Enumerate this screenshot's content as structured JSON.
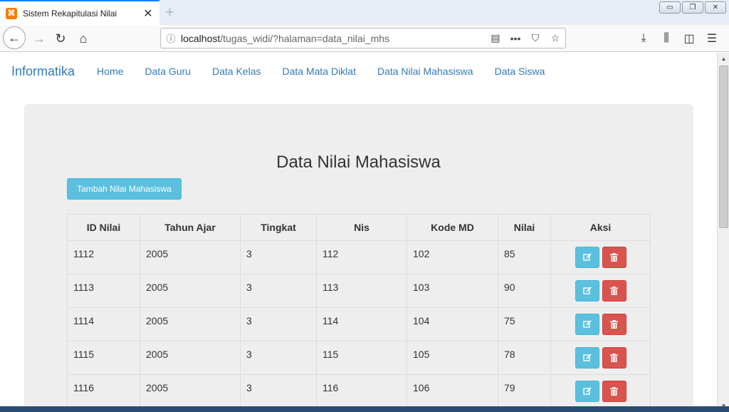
{
  "browser": {
    "tab_title": "Sistem Rekapitulasi Nilai",
    "url_host": "localhost",
    "url_path": "/tugas_widi/?halaman=data_nilai_mhs"
  },
  "site": {
    "brand": "Informatika",
    "nav": [
      "Home",
      "Data Guru",
      "Data Kelas",
      "Data Mata Diklat",
      "Data Nilai Mahasiswa",
      "Data Siswa"
    ]
  },
  "main": {
    "heading": "Data Nilai Mahasiswa",
    "add_button": "Tambah Nilai Mahasiswa"
  },
  "table": {
    "headers": [
      "ID Nilai",
      "Tahun Ajar",
      "Tingkat",
      "Nis",
      "Kode MD",
      "Nilai",
      "Aksi"
    ],
    "rows": [
      [
        "1112",
        "2005",
        "3",
        "112",
        "102",
        "85"
      ],
      [
        "1113",
        "2005",
        "3",
        "113",
        "103",
        "90"
      ],
      [
        "1114",
        "2005",
        "3",
        "114",
        "104",
        "75"
      ],
      [
        "1115",
        "2005",
        "3",
        "115",
        "105",
        "78"
      ],
      [
        "1116",
        "2005",
        "3",
        "116",
        "106",
        "79"
      ]
    ]
  },
  "colors": {
    "link": "#337ab7",
    "info": "#5bc0de",
    "danger": "#d9534f",
    "jumbotron": "#eeeeee"
  }
}
